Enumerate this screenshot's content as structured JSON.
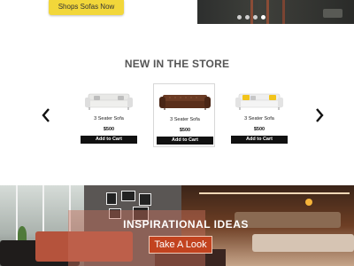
{
  "hero": {
    "shop_button": "Shops Sofas Now",
    "carousel_count": 4,
    "carousel_active_index": 3
  },
  "new_in_store": {
    "title": "NEW IN THE STORE",
    "products": [
      {
        "name": "3 Seater Sofa",
        "price": "$500",
        "cart_label": "Add to Cart",
        "image": "white-sofa-image",
        "colors": [
          "#e8e8e6",
          "#bdbdbd"
        ]
      },
      {
        "name": "3 Seater Sofa",
        "price": "$500",
        "cart_label": "Add to Cart",
        "image": "brown-chesterfield-sofa-image",
        "colors": [
          "#6b3b24",
          "#4a2616"
        ]
      },
      {
        "name": "3 Seater Sofa",
        "price": "$500",
        "cart_label": "Add to Cart",
        "image": "white-sofa-yellow-pillows-image",
        "colors": [
          "#efefef",
          "#f2c41c"
        ]
      }
    ]
  },
  "banner": {
    "title": "INSPIRATIONAL IDEAS",
    "button": "Take  A Look",
    "accent": "#c2431f"
  },
  "icons": {
    "prev": "chevron-left-icon",
    "next": "chevron-right-icon"
  }
}
